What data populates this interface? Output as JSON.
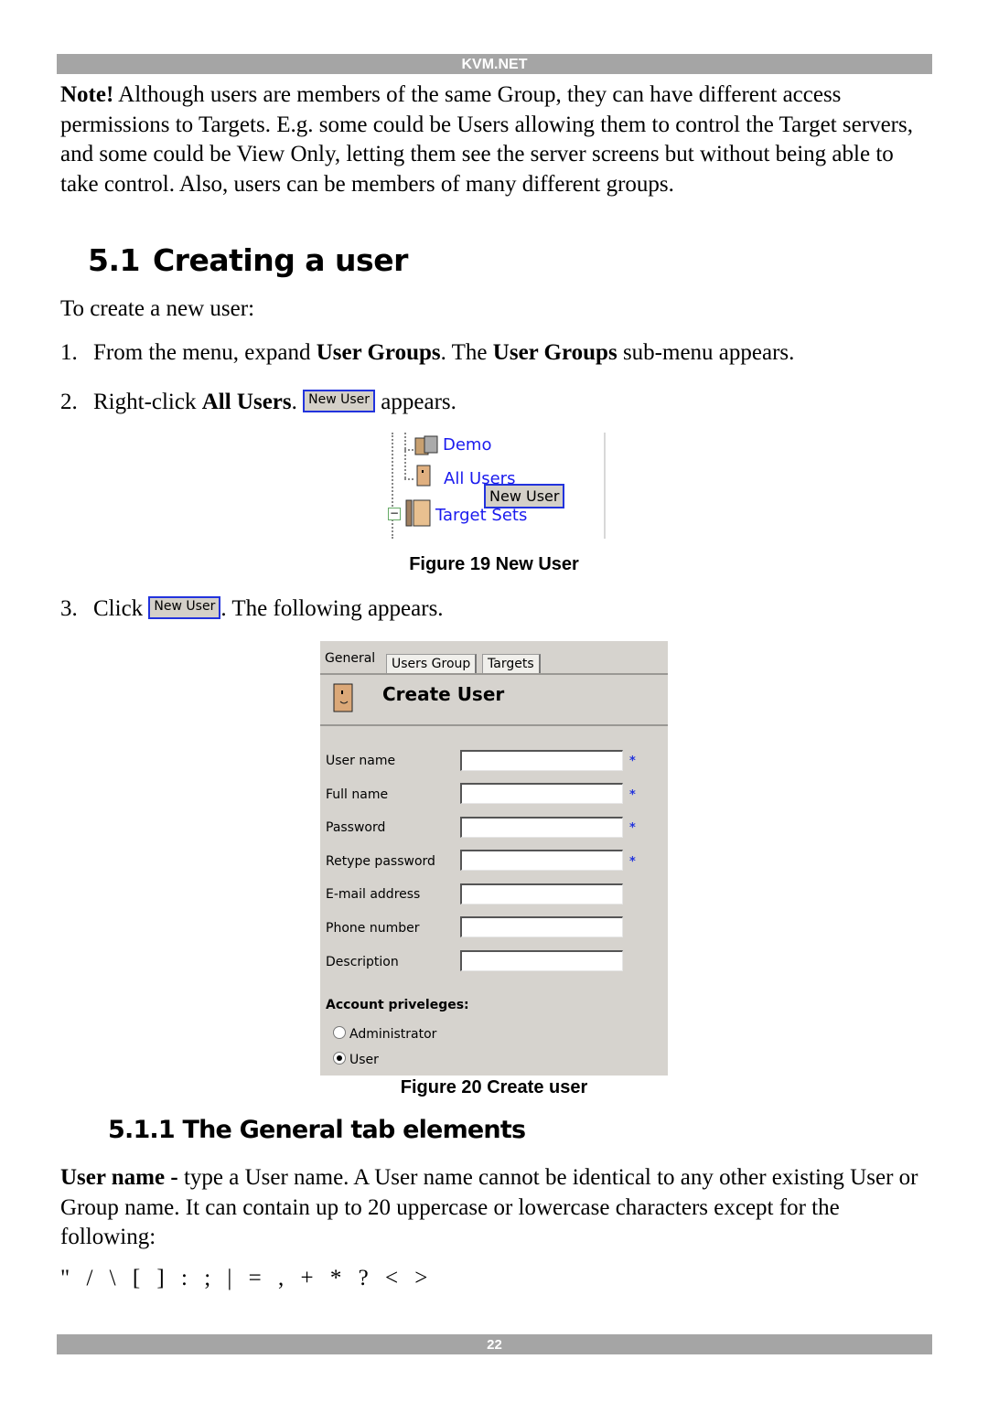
{
  "header": {
    "title": "KVM.NET"
  },
  "note": {
    "label": "Note!",
    "text": " Although users are members of the same Group, they can have different access permissions to Targets. E.g. some could be Users allowing them to control the Target servers, and some could be View Only, letting them see the server screens but without being able to take control. Also, users can be members of many different groups."
  },
  "section": {
    "number": "5.1",
    "title": "Creating a user"
  },
  "intro": "To create a new user:",
  "steps": [
    {
      "num": "1.",
      "parts": [
        "From the menu, expand ",
        "User Groups",
        ". The ",
        "User Groups",
        " sub-menu appears."
      ]
    },
    {
      "num": "2.",
      "parts": [
        "Right-click ",
        "All Users",
        ". ",
        " appears."
      ]
    },
    {
      "num": "3.",
      "parts": [
        "Click ",
        ". The following appears."
      ]
    }
  ],
  "new_user_button": "New User",
  "figure19": {
    "caption": "Figure 19 New User",
    "tree": [
      "Demo",
      "All Users",
      "Target Sets"
    ],
    "context_menu": "New User"
  },
  "figure20": {
    "caption": "Figure 20 Create user",
    "tabs": [
      "General",
      "Users Group",
      "Targets"
    ],
    "active_tab": "General",
    "title": "Create User",
    "fields": [
      {
        "label": "User name",
        "value": "",
        "required": true
      },
      {
        "label": "Full name",
        "value": "",
        "required": true
      },
      {
        "label": "Password",
        "value": "",
        "required": true
      },
      {
        "label": "Retype password",
        "value": "",
        "required": true
      },
      {
        "label": "E-mail address",
        "value": "",
        "required": false
      },
      {
        "label": "Phone number",
        "value": "",
        "required": false
      },
      {
        "label": "Description",
        "value": "",
        "required": false
      }
    ],
    "required_marker": "*",
    "privileges_label": "Account priveleges:",
    "privileges": [
      {
        "label": "Administrator",
        "checked": false
      },
      {
        "label": "User",
        "checked": true
      }
    ]
  },
  "subsection": {
    "number": "5.1.1",
    "title": "The General tab elements"
  },
  "user_name_desc": {
    "label": "User name -",
    "text": " type a User name. A User name cannot be identical to any other existing User or Group name. It can contain up to 20 uppercase or lowercase characters except for the following:"
  },
  "forbidden_chars": "\" / \\ [ ] : ; | = , + * ? < >",
  "footer": {
    "page": "22"
  }
}
